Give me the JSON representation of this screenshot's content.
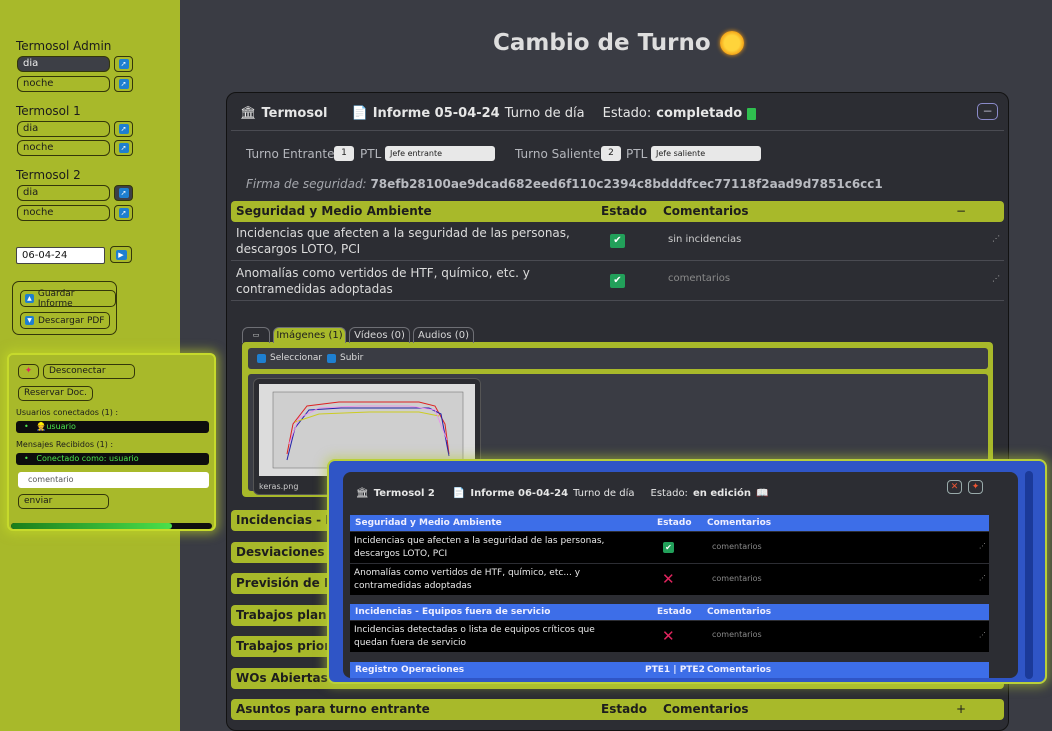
{
  "sidebar": {
    "groups": [
      {
        "title": "Termosol Admin",
        "shifts": [
          "dia",
          "noche"
        ]
      },
      {
        "title": "Termosol 1",
        "shifts": [
          "dia",
          "noche"
        ]
      },
      {
        "title": "Termosol 2",
        "shifts": [
          "dia",
          "noche"
        ]
      }
    ],
    "date_value": "06-04-24",
    "save_report_label": "Guardar Informe",
    "download_pdf_label": "Descargar PDF"
  },
  "chat": {
    "disconnect_label": "Desconectar",
    "reserve_label": "Reservar Doc.",
    "connected_users_label": "Usuarios conectados (1) :",
    "connected_user": "usuario",
    "messages_label": "Mensajes Recibidos (1) :",
    "message": "Conectado como: usuario",
    "comment_placeholder": "comentario",
    "send_label": "enviar",
    "progress": 0.8
  },
  "page": {
    "title": "Cambio de Turno"
  },
  "report": {
    "plant": "Termosol",
    "report_title": "Informe 05-04-24",
    "shift": "Turno de día",
    "state_label": "Estado:",
    "state_value": "completado",
    "incoming_label": "Turno Entrante",
    "incoming_num": "1",
    "ptl_label": "PTL",
    "incoming_chief": "Jefe entrante",
    "outgoing_label": "Turno Saliente",
    "outgoing_num": "2",
    "outgoing_chief": "Jefe saliente",
    "signature_label": "Firma de seguridad:",
    "signature_value": "78efb28100ae9dcad682eed6f110c2394c8bdddfcec77118f2aad9d7851c6cc1",
    "safety": {
      "title": "Seguridad y Medio Ambiente",
      "estado_label": "Estado",
      "comments_label": "Comentarios",
      "toggle": "−",
      "rows": [
        {
          "text": "Incidencias que afecten a la seguridad de las personas, descargos LOTO, PCI",
          "comment": "sin incidencias"
        },
        {
          "text": "Anomalías como vertidos de HTF, químico, etc. y contramedidas adoptadas",
          "comment": "comentarios"
        }
      ]
    },
    "media": {
      "tabs": [
        "▭",
        "Imágenes (1)",
        "Vídeos (0)",
        "Audios (0)"
      ],
      "select_label": "Seleccionar",
      "upload_label": "Subir",
      "file_name": "keras.png"
    },
    "collapsed_sections": [
      "Incidencias - Eq",
      "Desviaciones de",
      "Previsión de M",
      "Trabajos planifi",
      "Trabajos prioriz",
      "WOs Abiertas -"
    ],
    "last_section": {
      "title": "Asuntos para turno entrante",
      "estado_label": "Estado",
      "comments_label": "Comentarios",
      "toggle": "+"
    }
  },
  "float": {
    "plant": "Termosol 2",
    "report_title": "Informe 06-04-24",
    "shift": "Turno de día",
    "state_label": "Estado:",
    "state_value": "en edición",
    "sections": [
      {
        "title": "Seguridad y Medio Ambiente",
        "estado_label": "Estado",
        "comments_label": "Comentarios",
        "rows": [
          {
            "text": "Incidencias que afecten a la seguridad de las personas, descargos LOTO, PCI",
            "status": "ok",
            "comment": "comentarios"
          },
          {
            "text": "Anomalías como vertidos de HTF, químico, etc... y contramedidas adoptadas",
            "status": "no",
            "comment": "comentarios"
          }
        ]
      },
      {
        "title": "Incidencias - Equipos fuera de servicio",
        "estado_label": "Estado",
        "comments_label": "Comentarios",
        "rows": [
          {
            "text": "Incidencias detectadas o lista de equipos críticos que quedan fuera de servicio",
            "status": "no",
            "comment": "comentarios"
          }
        ]
      },
      {
        "title": "Registro Operaciones",
        "estado_label": "PTE1 | PTE2",
        "comments_label": "Comentarios",
        "rows": []
      }
    ]
  },
  "colors": {
    "accent": "#a8b92a",
    "float_blue": "#2f55c6",
    "ok": "#22a05a",
    "error": "#e0245e"
  }
}
